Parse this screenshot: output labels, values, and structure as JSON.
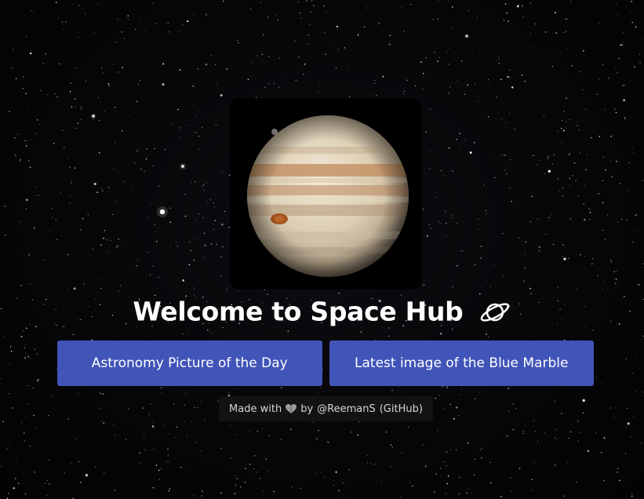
{
  "hero": {
    "image_alt": "Jupiter",
    "image_icon": "jupiter-planet-image"
  },
  "title": {
    "text": "Welcome to Space Hub",
    "icon": "ringed-planet-icon"
  },
  "nav": {
    "apod_label": "Astronomy Picture of the Day",
    "blue_marble_label": "Latest image of the Blue Marble"
  },
  "footer": {
    "made_with": "Made with",
    "heart_icon": "heart-icon",
    "by_text": "by",
    "author": "@ReemanS",
    "github": "(GitHub)"
  },
  "colors": {
    "button_bg": "#4154b8",
    "title_text": "#ffffff",
    "background": "#050507"
  }
}
